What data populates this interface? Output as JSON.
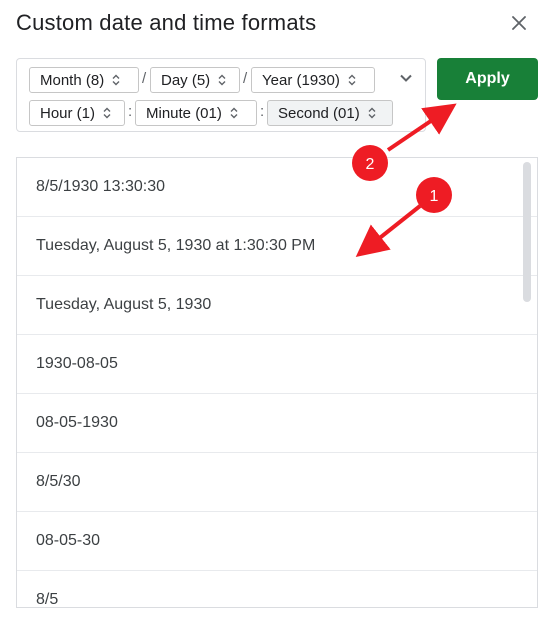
{
  "dialog": {
    "title": "Custom date and time formats"
  },
  "format_chips": {
    "row1": [
      {
        "label": "Month (8)"
      },
      {
        "label": "Day (5)"
      },
      {
        "label": "Year (1930)"
      }
    ],
    "row2": [
      {
        "label": "Hour (1)"
      },
      {
        "label": "Minute (01)"
      },
      {
        "label": "Second (01)"
      }
    ],
    "date_separator": "/",
    "time_separator": ":"
  },
  "apply_button": {
    "label": "Apply"
  },
  "format_list": [
    "8/5/1930 13:30:30",
    "Tuesday, August 5, 1930 at 1:30:30 PM",
    "Tuesday, August 5, 1930",
    "1930-08-05",
    "08-05-1930",
    "8/5/30",
    "08-05-30",
    "8/5"
  ],
  "annotations": {
    "badge1": "1",
    "badge2": "2",
    "color": "#ee1c24"
  },
  "icons": {
    "close": "close-icon",
    "stepper": "up-down-chevron-icon",
    "expand": "chevron-down-icon"
  },
  "colors": {
    "apply": "#188038",
    "title": "#202124",
    "border": "#dadce0"
  }
}
